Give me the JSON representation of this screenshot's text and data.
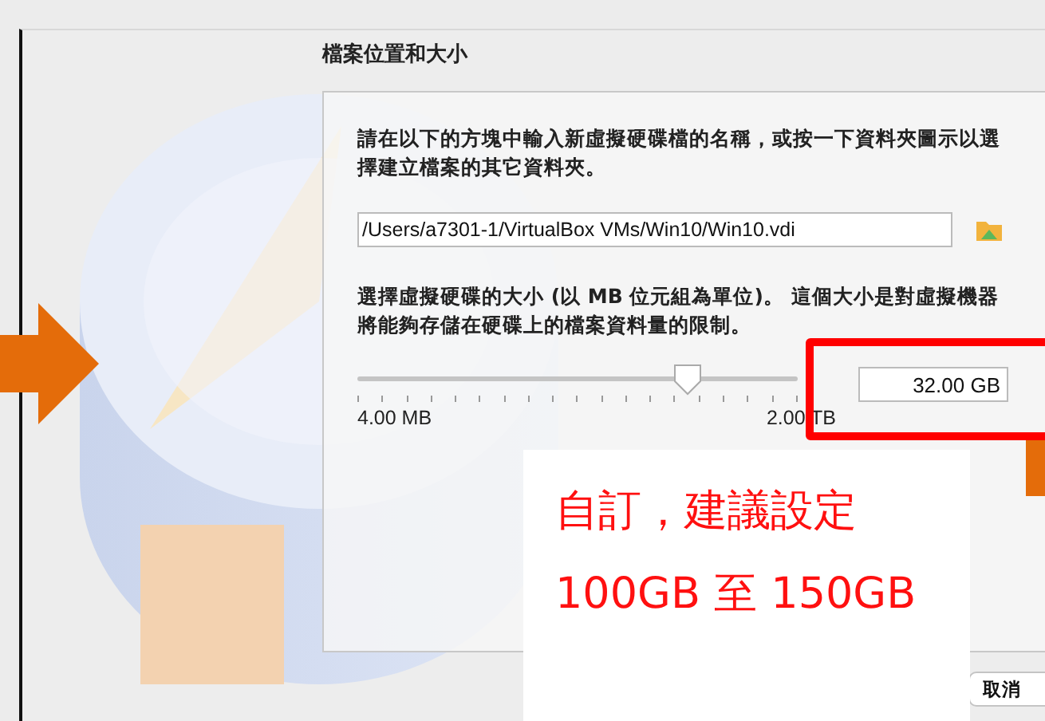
{
  "title": "檔案位置和大小",
  "instruction": "請在以下的方塊中輸入新虛擬硬碟檔的名稱，或按一下資料夾圖示以選擇建立檔案的其它資料夾。",
  "path_field": {
    "value": "/Users/a7301-1/VirtualBox VMs/Win10/Win10.vdi"
  },
  "size_description": "選擇虛擬硬碟的大小 (以 MB 位元組為單位)。 這個大小是對虛擬機器將能夠存儲在硬碟上的檔案資料量的限制。",
  "size_slider": {
    "level": 0.75,
    "min_label": "4.00 MB",
    "max_label": "2.00 TB"
  },
  "size_field": {
    "value": "32.00 GB"
  },
  "buttons": [
    "取消"
  ],
  "annotation": {
    "lines": [
      "自訂，建議設定",
      "100GB 至 150GB"
    ]
  }
}
